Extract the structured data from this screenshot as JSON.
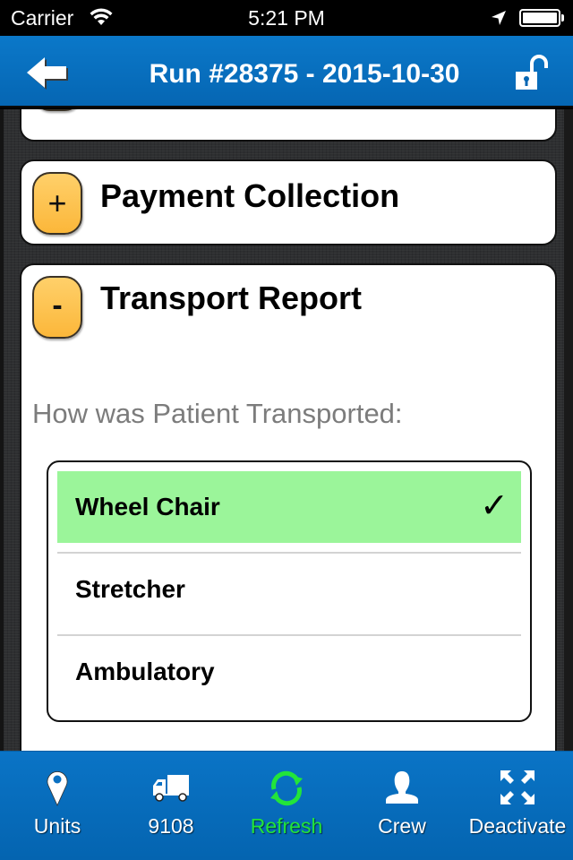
{
  "status_bar": {
    "carrier": "Carrier",
    "time": "5:21 PM",
    "icons": [
      "wifi-icon",
      "location-arrow-icon",
      "battery-icon"
    ]
  },
  "nav": {
    "title": "Run #28375 - 2015-10-30",
    "back_icon": "back-arrow-icon",
    "lock_icon": "unlocked-padlock-icon"
  },
  "sections": {
    "payment": {
      "title": "Payment Collection",
      "toggle": "+",
      "expanded": false
    },
    "transport": {
      "title": "Transport Report",
      "toggle": "-",
      "expanded": true,
      "question": "How was Patient Transported:",
      "options": [
        {
          "label": "Wheel Chair",
          "selected": true,
          "check": "✓"
        },
        {
          "label": "Stretcher",
          "selected": false
        },
        {
          "label": "Ambulatory",
          "selected": false
        }
      ]
    }
  },
  "tab_bar": {
    "tabs": [
      {
        "label": "Units",
        "icon": "map-pin-icon",
        "active": false
      },
      {
        "label": "9108",
        "icon": "truck-icon",
        "active": false
      },
      {
        "label": "Refresh",
        "icon": "refresh-icon",
        "active": true
      },
      {
        "label": "Crew",
        "icon": "person-icon",
        "active": false
      },
      {
        "label": "Deactivate",
        "icon": "expand-arrows-icon",
        "active": false
      }
    ]
  },
  "colors": {
    "nav_blue": "#0a74c6",
    "selected_green": "#9bf59a",
    "active_tab_green": "#22e43a",
    "toggle_orange": "#fbb73a"
  }
}
